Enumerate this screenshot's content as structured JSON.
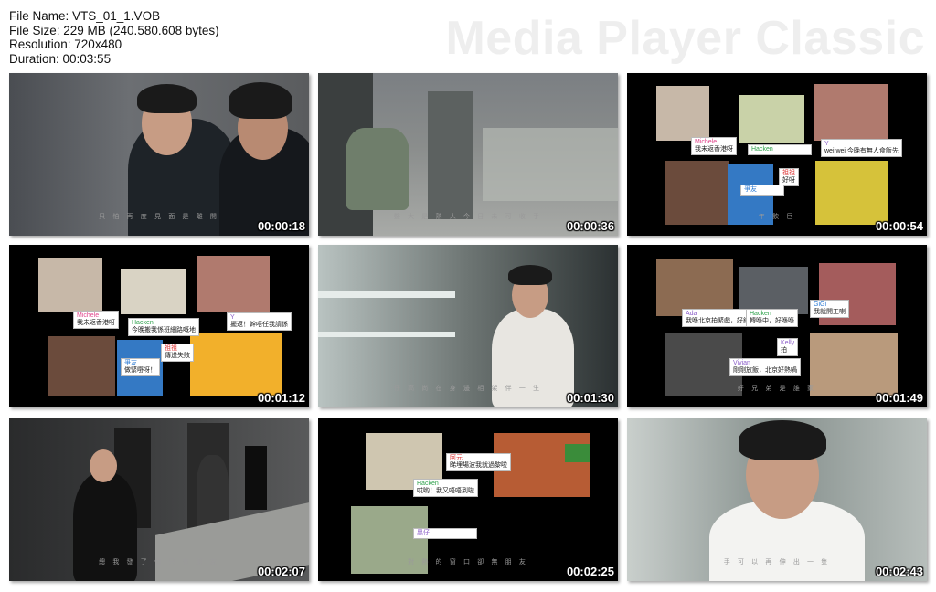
{
  "info": {
    "file_name": "File Name: VTS_01_1.VOB",
    "file_size": "File Size: 229 MB (240.580.608 bytes)",
    "resolution": "Resolution: 720x480",
    "duration": "Duration: 00:03:55"
  },
  "watermark": "Media Player Classic",
  "thumbs": [
    {
      "time": "00:00:18",
      "subtitle": "只 怕 再 度   見 面 是 離 開"
    },
    {
      "time": "00:00:36",
      "subtitle": "聲 大 是 熟 人      今 日 未 可 收 手"
    },
    {
      "time": "00:00:54",
      "subtitle": "年      飲 巨",
      "chats": [
        {
          "name": "Michele",
          "text": "我未返香港呀"
        },
        {
          "name": "Hacken",
          "text": ""
        },
        {
          "name": "Y",
          "text": "wei wei 今晚有無人食飯先"
        },
        {
          "name": "祖祖",
          "text": "好呀"
        },
        {
          "name": "爭友",
          "text": ""
        }
      ]
    },
    {
      "time": "00:01:12",
      "subtitle": "",
      "chats": [
        {
          "name": "Michele",
          "text": "我未返香港呀"
        },
        {
          "name": "Hacken",
          "text": "今晚搬我係班細路嘅地"
        },
        {
          "name": "Y",
          "text": "擺返！幹唔任我請係"
        },
        {
          "name": "祖祖",
          "text": "傳送失敗"
        },
        {
          "name": "爭友",
          "text": "做緊嘢呀！"
        }
      ]
    },
    {
      "time": "00:01:30",
      "subtitle": "仔 高 尚 在 身 邊 相 架 伴 一 生"
    },
    {
      "time": "00:01:49",
      "subtitle": "好 兄 弟 是 誰      家",
      "chats": [
        {
          "name": "Ada",
          "text": "我喺北京拍緊戲，好鍾意佢地做緊嘢呀"
        },
        {
          "name": "Hacken",
          "text": "轉喺中，好喺喺"
        },
        {
          "name": "GiGi",
          "text": "我就開工喇"
        },
        {
          "name": "Kelly",
          "text": "拍"
        },
        {
          "name": "Vivian",
          "text": "剛剛放飯，北京好熱喎"
        }
      ]
    },
    {
      "time": "00:02:07",
      "subtitle": "總 我 發 了 個      只 有 朋 友"
    },
    {
      "time": "00:02:25",
      "subtitle": "對      熱 的 窗 口      卻 無 朋 友",
      "chats": [
        {
          "name": "阿元",
          "text": "睇埋場波我就過黎啦"
        },
        {
          "name": "Hacken",
          "text": "哎喲！我又唔唔到啦"
        },
        {
          "name": "黑仔",
          "text": ""
        }
      ]
    },
    {
      "time": "00:02:43",
      "subtitle": "手 可 以 再 伸 出 一 隻"
    }
  ]
}
